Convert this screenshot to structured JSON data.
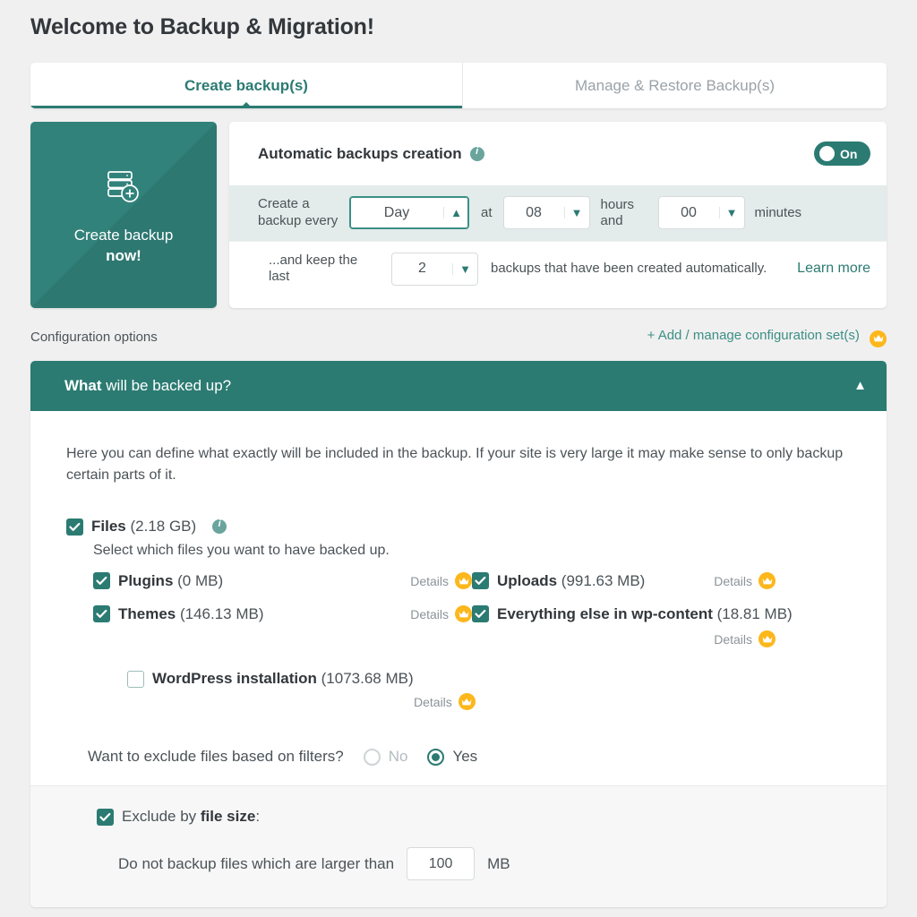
{
  "header": {
    "title": "Welcome to Backup & Migration!"
  },
  "tabs": [
    {
      "label": "Create backup(s)",
      "active": true
    },
    {
      "label": "Manage & Restore Backup(s)",
      "active": false
    }
  ],
  "create_backup_button": {
    "line1": "Create backup",
    "line2": "now!",
    "icon": "server-plus-icon"
  },
  "auto_backups": {
    "title": "Automatic backups creation",
    "info_icon": "info-icon",
    "toggle": {
      "state": "On",
      "enabled": true
    },
    "schedule": {
      "lead_label": "Create a backup every",
      "interval_value": "Day",
      "at_label": "at",
      "hours_value": "08",
      "hours_label": "hours and",
      "minutes_value": "00",
      "minutes_label": "minutes"
    },
    "retention": {
      "lead_label": "...and keep the last",
      "count_value": "2",
      "tail_label": "backups that have been created automatically.",
      "learn_more": "Learn more"
    }
  },
  "config_options": {
    "label": "Configuration options",
    "manage_link": "+ Add / manage configuration set(s)",
    "crown_icon": "crown-icon"
  },
  "what_section": {
    "title_bold": "What",
    "title_rest": " will be backed up?",
    "chevron": "chevron-up-icon",
    "description": "Here you can define what exactly will be included in the backup. If your site is very large it may make sense to only backup certain parts of it.",
    "files": {
      "label_bold": "Files",
      "size": "(2.18 GB)",
      "checked": true,
      "info_icon": "info-icon",
      "note": "Select which files you want to have backed up.",
      "details_label": "Details",
      "left_items": [
        {
          "label": "Plugins",
          "size": "(0 MB)",
          "checked": true,
          "details": "Details"
        },
        {
          "label": "Themes",
          "size": "(146.13 MB)",
          "checked": true,
          "details": "Details"
        }
      ],
      "right_items": [
        {
          "label": "Uploads",
          "size": "(991.63 MB)",
          "checked": true,
          "details": "Details"
        },
        {
          "label": "Everything else in wp-content",
          "size": "(18.81 MB)",
          "checked": true,
          "details": "Details"
        }
      ],
      "wordpress": {
        "label": "WordPress installation",
        "size": "(1073.68 MB)",
        "checked": false,
        "details": "Details"
      }
    },
    "filters": {
      "question": "Want to exclude files based on filters?",
      "option_no": "No",
      "option_yes": "Yes",
      "selected": "Yes"
    },
    "exclude_size": {
      "label_prefix": "Exclude by ",
      "label_bold": "file size",
      "label_suffix": ":",
      "checked": true,
      "rule_text": "Do not backup files which are larger than",
      "value": "100",
      "unit": "MB"
    }
  },
  "colors": {
    "teal": "#2b7b72",
    "teal_light": "#3c8f86",
    "crown_amber": "#fcb71b",
    "page_bg": "#f0f0f0"
  }
}
